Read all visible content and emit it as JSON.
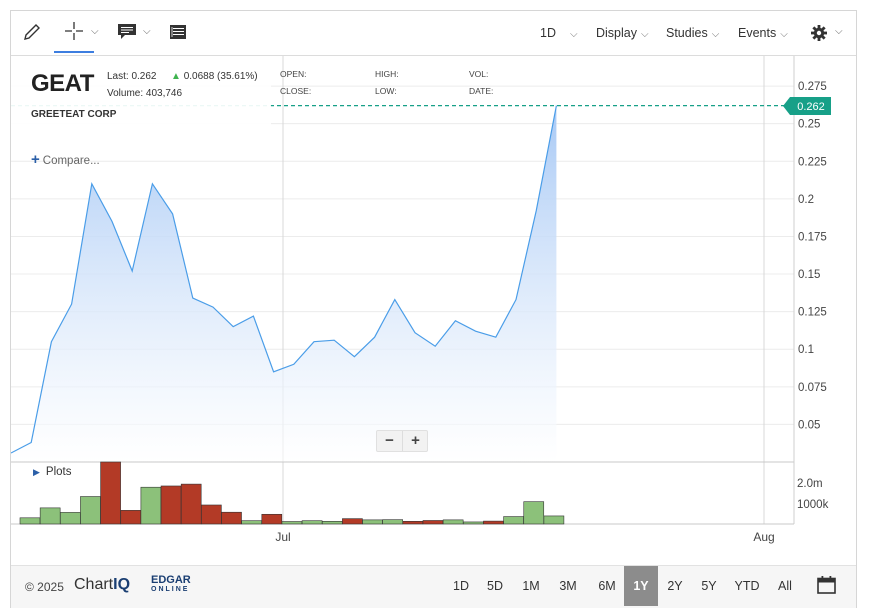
{
  "toolbar": {
    "icons": [
      "pencil-icon",
      "crosshair-icon",
      "comment-icon",
      "table-icon",
      "gear-icon"
    ],
    "interval": "1D",
    "display_label": "Display",
    "studies_label": "Studies",
    "events_label": "Events"
  },
  "hud": {
    "symbol": "GEAT",
    "last": "Last: 0.262",
    "change": "0.0688 (35.61%)",
    "volume": "Volume: 403,746",
    "company": "GREETEAT CORP",
    "open": "OPEN:",
    "close": "CLOSE:",
    "high": "HIGH:",
    "low": "LOW:",
    "vol": "VOL:",
    "date": "DATE:"
  },
  "compare_label": "Compare...",
  "plots_label": "Plots",
  "zoom": {
    "minus": "−",
    "plus": "+"
  },
  "current_price": "0.262",
  "colors": {
    "line": "#4a9de8",
    "area_top": "#a8c9f5",
    "area_bottom": "#ffffff",
    "price_tag": "#17a088",
    "vol_up": "#8cc17a",
    "vol_down": "#b33a26",
    "selected_range": "#8c8c8c"
  },
  "chart_data": {
    "type": "area",
    "x": [
      1,
      2,
      3,
      4,
      5,
      6,
      7,
      8,
      9,
      10,
      11,
      12,
      13,
      14,
      15,
      16,
      17,
      18,
      19,
      20,
      21,
      22,
      23,
      24,
      25,
      26,
      27,
      28
    ],
    "y": [
      0.031,
      0.038,
      0.105,
      0.13,
      0.21,
      0.185,
      0.152,
      0.21,
      0.19,
      0.134,
      0.128,
      0.115,
      0.122,
      0.085,
      0.09,
      0.105,
      0.106,
      0.095,
      0.108,
      0.133,
      0.111,
      0.102,
      0.119,
      0.112,
      0.108,
      0.133,
      0.192,
      0.262
    ],
    "ylim": [
      0.025,
      0.295
    ],
    "y_ticks": [
      "0.275",
      "0.25",
      "0.225",
      "0.2",
      "0.175",
      "0.15",
      "0.125",
      "0.1",
      "0.075",
      "0.05"
    ],
    "x_ticks": [
      "Jul",
      "Aug"
    ],
    "volume_ticks": [
      "2.0m",
      "1000k"
    ]
  },
  "volume_data": {
    "values": [
      300,
      780,
      560,
      1330,
      3000,
      660,
      1780,
      1840,
      1930,
      920,
      570,
      160,
      470,
      120,
      160,
      130,
      260,
      200,
      210,
      130,
      170,
      200,
      100,
      140,
      360,
      1080,
      390
    ],
    "direction": [
      "up",
      "up",
      "up",
      "up",
      "down",
      "down",
      "up",
      "down",
      "down",
      "down",
      "down",
      "up",
      "down",
      "up",
      "up",
      "up",
      "down",
      "up",
      "up",
      "down",
      "down",
      "up",
      "up",
      "down",
      "up",
      "up",
      "up"
    ]
  },
  "footer": {
    "copyright": "© 2025",
    "chartiq_a": "Chart",
    "chartiq_b": "IQ",
    "edgar": "EDGAR",
    "edgar_sub": "ONLINE",
    "ranges": [
      "1D",
      "5D",
      "1M",
      "3M",
      "6M",
      "1Y",
      "2Y",
      "5Y",
      "YTD",
      "All"
    ],
    "selected": "1Y"
  }
}
